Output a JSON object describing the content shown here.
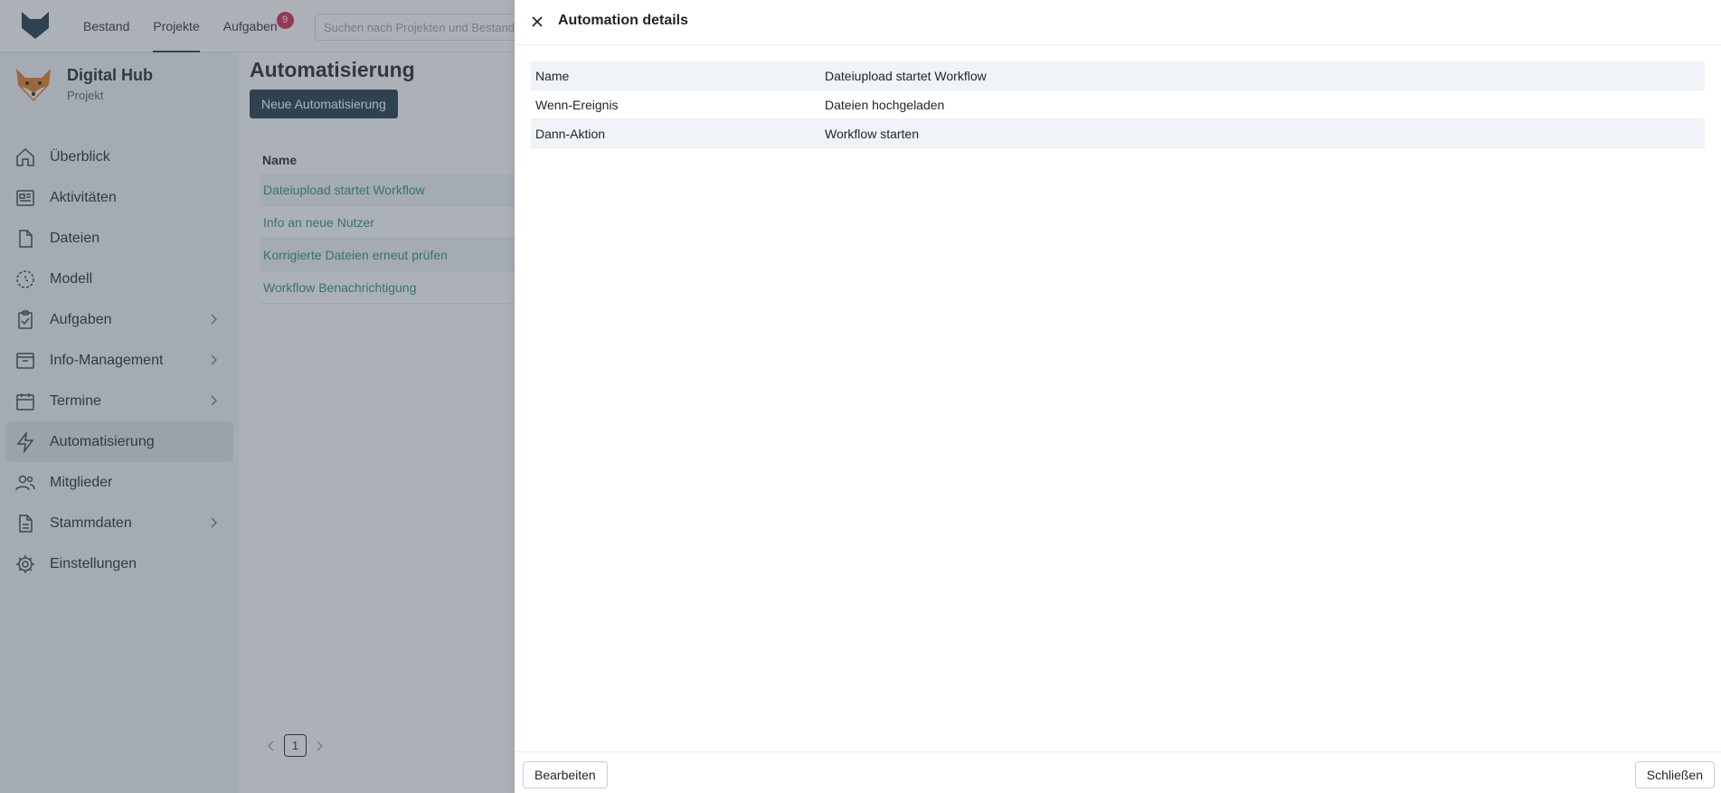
{
  "topnav": {
    "items": [
      {
        "label": "Bestand"
      },
      {
        "label": "Projekte"
      },
      {
        "label": "Aufgaben"
      }
    ],
    "tasks_badge": "9",
    "search_placeholder": "Suchen nach Projekten und Bestand"
  },
  "project": {
    "name": "Digital Hub",
    "subtitle": "Projekt"
  },
  "sidebar": {
    "items": [
      {
        "label": "Überblick"
      },
      {
        "label": "Aktivitäten"
      },
      {
        "label": "Dateien"
      },
      {
        "label": "Modell"
      },
      {
        "label": "Aufgaben"
      },
      {
        "label": "Info-Management"
      },
      {
        "label": "Termine"
      },
      {
        "label": "Automatisierung"
      },
      {
        "label": "Mitglieder"
      },
      {
        "label": "Stammdaten"
      },
      {
        "label": "Einstellungen"
      }
    ]
  },
  "main": {
    "title": "Automatisierung",
    "new_button": "Neue Automatisierung",
    "table_header": "Name",
    "rows": [
      "Dateiupload startet Workflow",
      "Info an neue Nutzer",
      "Korrigierte Dateien erneut prüfen",
      "Workflow Benachrichtigung"
    ],
    "page": "1"
  },
  "drawer": {
    "title": "Automation details",
    "details": [
      {
        "label": "Name",
        "value": "Dateiupload startet Workflow"
      },
      {
        "label": "Wenn-Ereignis",
        "value": "Dateien hochgeladen"
      },
      {
        "label": "Dann-Aktion",
        "value": "Workflow starten"
      }
    ],
    "edit_button": "Bearbeiten",
    "close_button": "Schließen"
  },
  "colors": {
    "primary": "#1d3546",
    "link": "#2a8a83",
    "badge": "#d6264b",
    "active_nav": "#dfe4ea"
  }
}
